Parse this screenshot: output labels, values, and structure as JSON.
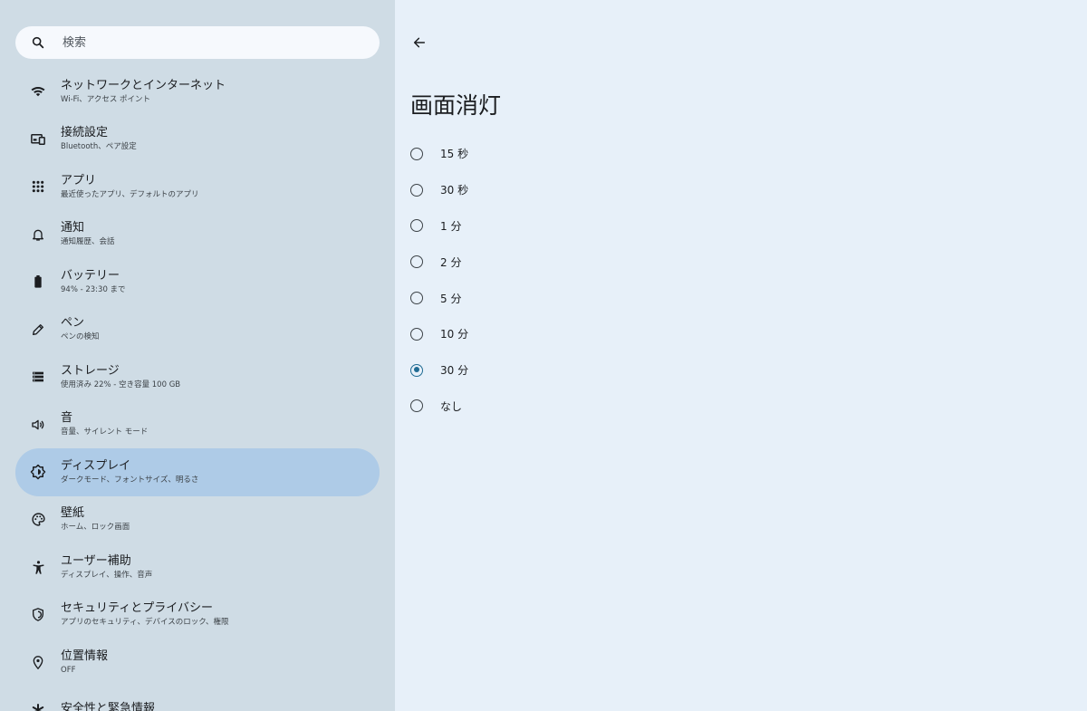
{
  "search": {
    "placeholder": "検索"
  },
  "menu": [
    {
      "title": "ネットワークとインターネット",
      "sub": "Wi-Fi、アクセス ポイント",
      "icon": "wifi-icon"
    },
    {
      "title": "接続設定",
      "sub": "Bluetooth、ペア設定",
      "icon": "devices-icon"
    },
    {
      "title": "アプリ",
      "sub": "最近使ったアプリ、デフォルトのアプリ",
      "icon": "apps-grid-icon"
    },
    {
      "title": "通知",
      "sub": "通知履歴、会話",
      "icon": "bell-icon"
    },
    {
      "title": "バッテリー",
      "sub": "94% - 23:30 まで",
      "icon": "battery-icon"
    },
    {
      "title": "ペン",
      "sub": "ペンの検知",
      "icon": "pen-icon"
    },
    {
      "title": "ストレージ",
      "sub": "使用済み 22% - 空き容量 100 GB",
      "icon": "storage-icon"
    },
    {
      "title": "音",
      "sub": "音量、サイレント モード",
      "icon": "volume-icon"
    },
    {
      "title": "ディスプレイ",
      "sub": "ダークモード、フォントサイズ、明るさ",
      "icon": "brightness-icon"
    },
    {
      "title": "壁紙",
      "sub": "ホーム、ロック画面",
      "icon": "palette-icon"
    },
    {
      "title": "ユーザー補助",
      "sub": "ディスプレイ、操作、音声",
      "icon": "accessibility-icon"
    },
    {
      "title": "セキュリティとプライバシー",
      "sub": "アプリのセキュリティ、デバイスのロック、権限",
      "icon": "shield-icon"
    },
    {
      "title": "位置情報",
      "sub": "OFF",
      "icon": "location-pin-icon"
    },
    {
      "title": "安全性と緊急情報",
      "sub": "",
      "icon": "asterisk-icon"
    }
  ],
  "active_menu_index": 8,
  "detail": {
    "title": "画面消灯",
    "options": [
      "15 秒",
      "30 秒",
      "1 分",
      "2 分",
      "5 分",
      "10 分",
      "30 分",
      "なし"
    ],
    "selected_index": 6
  },
  "colors": {
    "accent": "#1f6b93",
    "active_bg": "#aecbe7",
    "left_bg": "#cfdce5",
    "right_bg": "#e7f0f9"
  }
}
